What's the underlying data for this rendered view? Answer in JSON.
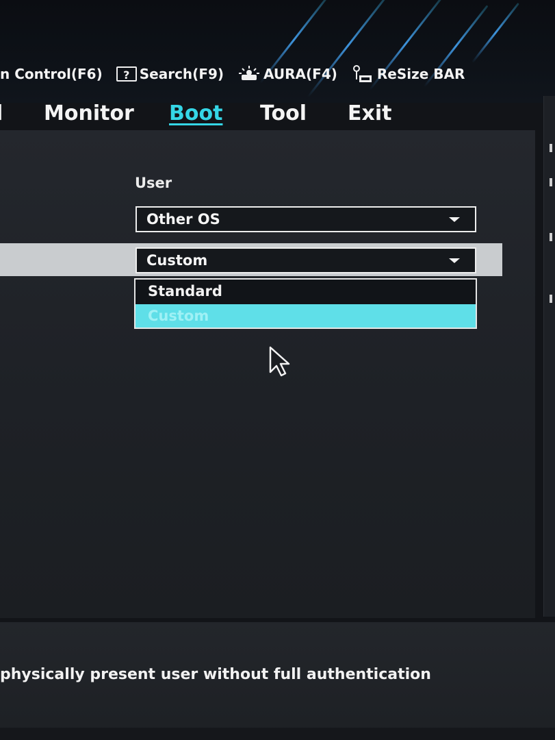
{
  "hotkeys": [
    {
      "label": "n Control(F6)",
      "icon": "none"
    },
    {
      "label": "Search(F9)",
      "icon": "question-box-icon"
    },
    {
      "label": "AURA(F4)",
      "icon": "aura-light-icon"
    },
    {
      "label": "ReSize BAR",
      "icon": "resize-bar-icon"
    }
  ],
  "tabs": {
    "partial": "l",
    "monitor": "Monitor",
    "boot": "Boot",
    "tool": "Tool",
    "exit": "Exit",
    "active": "Boot"
  },
  "settings": {
    "user_label": "User",
    "os_type_value": "Other OS",
    "key_mode_value": "Custom"
  },
  "dropdown": {
    "options": [
      "Standard",
      "Custom"
    ],
    "selected": "Custom"
  },
  "help_text": "physically present user without full authentication",
  "colors": {
    "accent": "#35d6e6",
    "selected_option_bg": "#5fdfe8",
    "row_highlight": "#c9cccf"
  }
}
